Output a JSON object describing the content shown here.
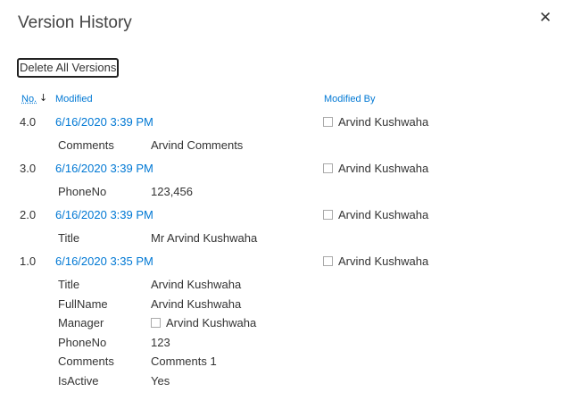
{
  "title": "Version History",
  "close_icon": "close-icon",
  "delete_all_label": "Delete All Versions",
  "headers": {
    "no": "No.",
    "modified": "Modified",
    "modified_by": "Modified By"
  },
  "versions": [
    {
      "no": "4.0",
      "modified": "6/16/2020 3:39 PM",
      "modified_by": "Arvind Kushwaha",
      "changes": [
        {
          "field": "Comments",
          "value": "Arvind Comments"
        }
      ]
    },
    {
      "no": "3.0",
      "modified": "6/16/2020 3:39 PM",
      "modified_by": "Arvind Kushwaha",
      "changes": [
        {
          "field": "PhoneNo",
          "value": "123,456"
        }
      ]
    },
    {
      "no": "2.0",
      "modified": "6/16/2020 3:39 PM",
      "modified_by": "Arvind Kushwaha",
      "changes": [
        {
          "field": "Title",
          "value": "Mr Arvind Kushwaha"
        }
      ]
    },
    {
      "no": "1.0",
      "modified": "6/16/2020 3:35 PM",
      "modified_by": "Arvind Kushwaha",
      "changes": [
        {
          "field": "Title",
          "value": "Arvind Kushwaha"
        },
        {
          "field": "FullName",
          "value": "Arvind Kushwaha"
        },
        {
          "field": "Manager",
          "value": "Arvind Kushwaha",
          "person": true
        },
        {
          "field": "PhoneNo",
          "value": "123"
        },
        {
          "field": "Comments",
          "value": "Comments 1"
        },
        {
          "field": "IsActive",
          "value": "Yes"
        }
      ]
    }
  ]
}
